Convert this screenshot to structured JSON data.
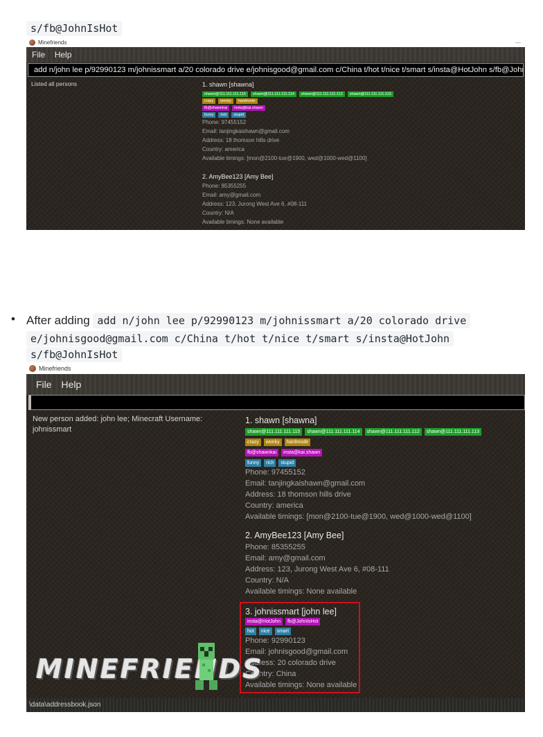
{
  "top": {
    "code_tail": "s/fb@JohnIsHot"
  },
  "window1": {
    "title": "Minefriends",
    "minimize": "—",
    "menu": {
      "file": "File",
      "help": "Help"
    },
    "command_text": "add n/john lee p/92990123 m/johnissmart a/20 colorado drive e/johnisgood@gmail.com c/China t/hot t/nice t/smart s/insta@HotJohn s/fb@JohnIsHot",
    "result": "Listed all persons",
    "persons": [
      {
        "name": "1.  shawn [shawna]",
        "ips": [
          "shawn@111.111.111.115",
          "shawn@111.111.111.114",
          "shawn@111.111.111.112",
          "shawn@111.111.111.113"
        ],
        "tags": [
          "crazy",
          "wonky",
          "hardmode"
        ],
        "socials": [
          "fb@shawnkai",
          "insta@kai.shawn"
        ],
        "timings": [
          "funny",
          "rich",
          "stupid"
        ],
        "phone": "Phone: 97455152",
        "email": "Email: tanjingkaishawn@gmail.com",
        "address": "Address: 18 thomson hills drive",
        "country": "Country: america",
        "available": "Available timings: [mon@2100-tue@1900, wed@1000-wed@1100]"
      },
      {
        "name": "2.  AmyBee123 [Amy Bee]",
        "phone": "Phone: 85355255",
        "email": "Email: amy@gmail.com",
        "address": "Address: 123, Jurong West Ave 6, #08-111",
        "country": "Country: N/A",
        "available": "Available timings: None available"
      }
    ]
  },
  "caption": {
    "bullet": "•",
    "lead": "After adding",
    "code_line1": "add n/john lee p/92990123 m/johnissmart a/20 colorado drive",
    "code_line2": "e/johnisgood@gmail.com c/China t/hot t/nice t/smart s/insta@HotJohn",
    "code_line3": "s/fb@JohnIsHot"
  },
  "window2": {
    "title": "Minefriends",
    "menu": {
      "file": "File",
      "help": "Help"
    },
    "command_text": "",
    "result_line1": "New person added: john lee; Minecraft Username:",
    "result_line2": "johnissmart",
    "logo": "MINEFRIENDS",
    "status": "\\data\\addressbook.json",
    "persons": [
      {
        "name": "1.  shawn [shawna]",
        "ips": [
          "shawn@111.111.111.115",
          "shawn@111.111.111.114",
          "shawn@111.111.111.112",
          "shawn@111.111.111.113"
        ],
        "tags": [
          "crazy",
          "wonky",
          "hardmode"
        ],
        "socials": [
          "fb@shawnkai",
          "insta@kai.shawn"
        ],
        "timings": [
          "funny",
          "rich",
          "stupid"
        ],
        "phone": "Phone: 97455152",
        "email": "Email: tanjingkaishawn@gmail.com",
        "address": "Address: 18 thomson hills drive",
        "country": "Country: america",
        "available": "Available timings: [mon@2100-tue@1900, wed@1000-wed@1100]"
      },
      {
        "name": "2.  AmyBee123 [Amy Bee]",
        "phone": "Phone: 85355255",
        "email": "Email: amy@gmail.com",
        "address": "Address: 123, Jurong West Ave 6, #08-111",
        "country": "Country: N/A",
        "available": "Available timings: None available"
      },
      {
        "name": "3.  johnissmart [john lee]",
        "socials": [
          "insta@HotJohn",
          "fb@JohnIsHot"
        ],
        "tags": [
          "hot",
          "nice",
          "smart"
        ],
        "phone": "Phone: 92990123",
        "email": "Email: johnisgood@gmail.com",
        "address": "Address: 20 colorado drive",
        "country": "Country: China",
        "available": "Available timings: None available"
      }
    ]
  },
  "colors": {
    "ip_tag": "#1d9e2a",
    "tag": "#b0860f",
    "social_tag": "#b513b8",
    "timing_tag": "#2f7fa3",
    "highlight_border": "#d0101a"
  }
}
